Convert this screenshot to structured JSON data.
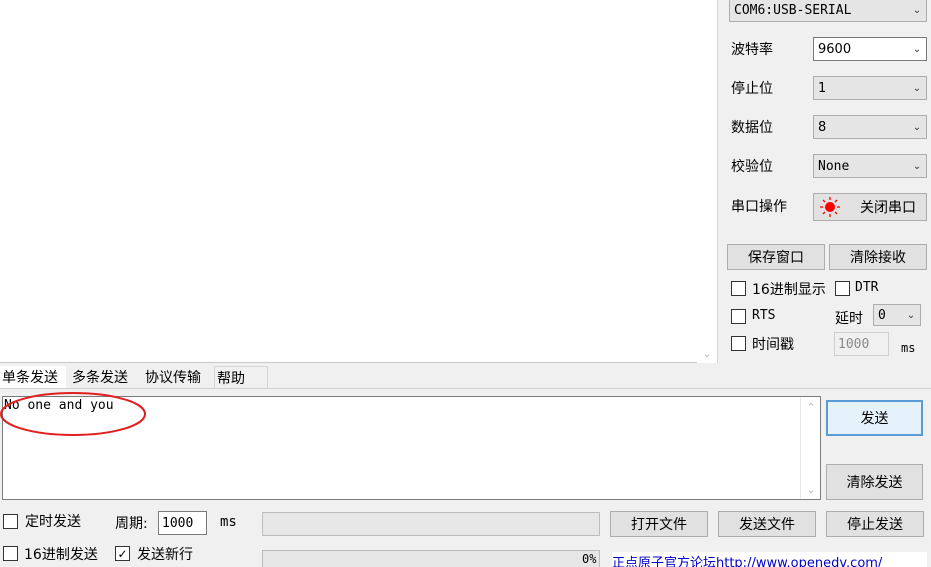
{
  "serial": {
    "port_value": "COM6:USB-SERIAL",
    "baud": {
      "label": "波特率",
      "value": "9600"
    },
    "stop_bits": {
      "label": "停止位",
      "value": "1"
    },
    "data_bits": {
      "label": "数据位",
      "value": "8"
    },
    "parity": {
      "label": "校验位",
      "value": "None"
    },
    "operation": {
      "label": "串口操作",
      "button": "关闭串口"
    }
  },
  "receive_controls": {
    "save_window": "保存窗口",
    "clear_receive": "清除接收",
    "hex_display": "16进制显示",
    "dtr": "DTR",
    "rts": "RTS",
    "delay_label": "延时",
    "delay_value": "0",
    "timestamp": "时间戳",
    "timestamp_value": "1000",
    "timestamp_unit": "ms"
  },
  "tabs": [
    "单条发送",
    "多条发送",
    "协议传输",
    "帮助"
  ],
  "send": {
    "text": "No one and you",
    "send_button": "发送",
    "clear_button": "清除发送"
  },
  "bottom": {
    "timed_send": "定时发送",
    "period_label": "周期:",
    "period_value": "1000",
    "period_unit": "ms",
    "open_file": "打开文件",
    "send_file": "发送文件",
    "stop_send": "停止发送",
    "hex_send": "16进制发送",
    "send_newline": "发送新行",
    "send_newline_checked": true,
    "progress": "0%",
    "progress_fraction": 0,
    "forum_link": "正点原子官方论坛http://www.openedv.com/"
  },
  "colors": {
    "focus_border": "#5b9bd5",
    "annotation_red": "#e02020",
    "indicator_red": "#ff0000",
    "link_blue": "#0000cc"
  }
}
